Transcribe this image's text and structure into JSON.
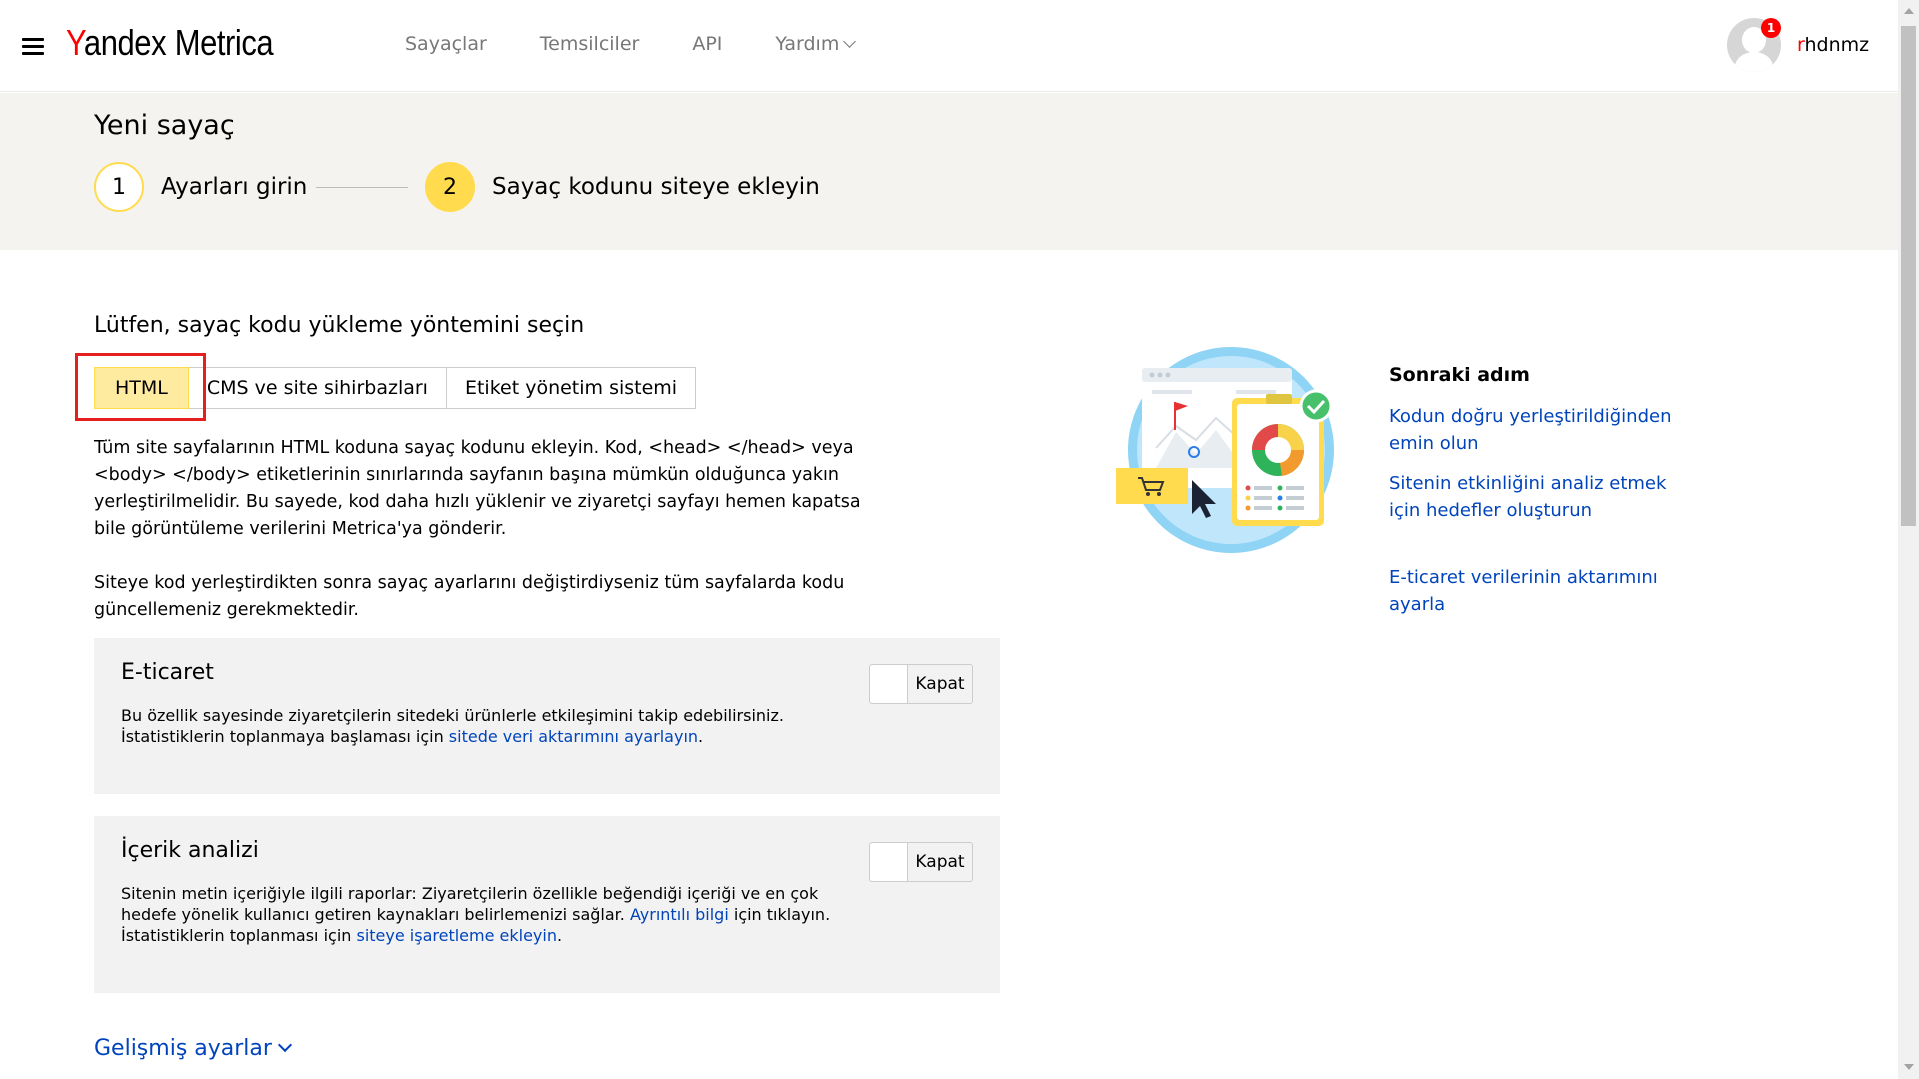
{
  "header": {
    "logo_y": "Y",
    "logo_rest": "andex",
    "logo_metrica": "Metrica",
    "nav": [
      "Sayaçlar",
      "Temsilciler",
      "API",
      "Yardım"
    ],
    "notification_count": "1",
    "username_first": "r",
    "username_rest": "hdnmz"
  },
  "page": {
    "title": "Yeni sayaç",
    "steps": [
      {
        "number": "1",
        "label": "Ayarları girin"
      },
      {
        "number": "2",
        "label": "Sayaç kodunu siteye ekleyin"
      }
    ]
  },
  "main": {
    "section_title": "Lütfen, sayaç kodu yükleme yöntemini seçin",
    "tabs": [
      "HTML",
      "CMS ve site sihirbazları",
      "Etiket yönetim sistemi"
    ],
    "para1": "Tüm site sayfalarının HTML koduna sayaç kodunu ekleyin. Kod, <head> </head> veya <body> </body> etiketlerinin sınırlarında sayfanın başına mümkün olduğunca yakın yerleştirilmelidir. Bu sayede, kod daha hızlı yüklenir ve ziyaretçi sayfayı hemen kapatsa bile görüntüleme verilerini Metrica'ya gönderir.",
    "para2": "Siteye kod yerleştirdikten sonra sayaç ayarlarını değiştirdiyseniz tüm sayfalarda kodu güncellemeniz gerekmektedir.",
    "ecommerce": {
      "title": "E-ticaret",
      "text1": "Bu özellik sayesinde ziyaretçilerin sitedeki ürünlerle etkileşimini takip edebilirsiniz.",
      "text2": "İstatistiklerin toplanmaya başlaması için ",
      "link": "sitede veri aktarımını ayarlayın",
      "text3": ".",
      "toggle": "Kapat"
    },
    "content": {
      "title": "İçerik analizi",
      "text1": "Sitenin metin içeriğiyle ilgili raporlar: Ziyaretçilerin özellikle beğendiği içeriği ve en çok hedefe yönelik kullanıcı getiren kaynakları belirlemenizi sağlar. ",
      "link1": "Ayrıntılı bilgi",
      "text2": " için tıklayın.",
      "text3": "İstatistiklerin toplanması için ",
      "link2": "siteye işaretleme ekleyin",
      "text4": ".",
      "toggle": "Kapat"
    },
    "advanced": "Gelişmiş ayarlar"
  },
  "next_step": {
    "title": "Sonraki adım",
    "links": [
      "Kodun doğru yerleştirildiğinden emin olun",
      "Sitenin etkinliğini analiz etmek için hedefler oluşturun",
      "E-ticaret verilerinin aktarımını ayarla"
    ]
  },
  "colors": {
    "accent_yellow": "#ffdb4d",
    "link_blue": "#0044bb",
    "highlight_red": "#e61e1e"
  }
}
